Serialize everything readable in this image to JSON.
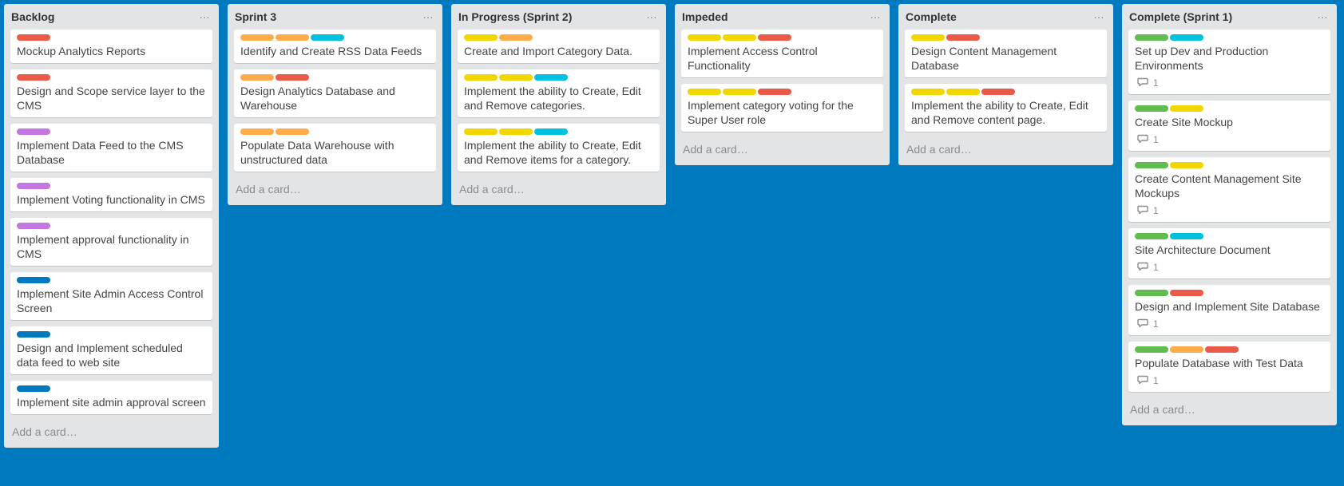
{
  "colors": {
    "board_background": "#0079bf",
    "green": "#61bd4f",
    "yellow": "#f2d600",
    "orange": "#ffab4a",
    "red": "#eb5a46",
    "purple": "#c377e0",
    "blue": "#0079bf",
    "sky": "#00c2e0"
  },
  "add_card_label": "Add a card…",
  "menu_glyph": "…",
  "lists": [
    {
      "title": "Backlog",
      "cards": [
        {
          "labels": [
            "red"
          ],
          "title": "Mockup Analytics Reports"
        },
        {
          "labels": [
            "red"
          ],
          "title": "Design and Scope service layer to the CMS"
        },
        {
          "labels": [
            "purple"
          ],
          "title": "Implement Data Feed to the CMS Database"
        },
        {
          "labels": [
            "purple"
          ],
          "title": "Implement Voting functionality in CMS"
        },
        {
          "labels": [
            "purple"
          ],
          "title": "Implement approval functionality in CMS"
        },
        {
          "labels": [
            "blue"
          ],
          "title": "Implement Site Admin Access Control Screen"
        },
        {
          "labels": [
            "blue"
          ],
          "title": "Design and Implement scheduled data feed to web site"
        },
        {
          "labels": [
            "blue"
          ],
          "title": "Implement site admin approval screen"
        }
      ]
    },
    {
      "title": "Sprint 3",
      "cards": [
        {
          "labels": [
            "orange",
            "orange",
            "sky"
          ],
          "title": "Identify and Create RSS Data Feeds"
        },
        {
          "labels": [
            "orange",
            "red"
          ],
          "title": "Design Analytics Database and Warehouse"
        },
        {
          "labels": [
            "orange",
            "orange"
          ],
          "title": "Populate Data Warehouse with unstructured data"
        }
      ]
    },
    {
      "title": "In Progress (Sprint 2)",
      "cards": [
        {
          "labels": [
            "yellow",
            "orange"
          ],
          "title": "Create and Import Category Data."
        },
        {
          "labels": [
            "yellow",
            "yellow",
            "sky"
          ],
          "title": "Implement the ability to Create, Edit and Remove categories."
        },
        {
          "labels": [
            "yellow",
            "yellow",
            "sky"
          ],
          "title": "Implement the ability to Create, Edit and Remove items for a category."
        }
      ]
    },
    {
      "title": "Impeded",
      "cards": [
        {
          "labels": [
            "yellow",
            "yellow",
            "red"
          ],
          "title": "Implement Access Control Functionality"
        },
        {
          "labels": [
            "yellow",
            "yellow",
            "red"
          ],
          "title": "Implement category voting for the Super User role"
        }
      ]
    },
    {
      "title": "Complete",
      "cards": [
        {
          "labels": [
            "yellow",
            "red"
          ],
          "title": "Design Content Management Database"
        },
        {
          "labels": [
            "yellow",
            "yellow",
            "red"
          ],
          "title": "Implement the ability to Create, Edit and Remove content page."
        }
      ]
    },
    {
      "title": "Complete (Sprint 1)",
      "cards": [
        {
          "labels": [
            "green",
            "sky"
          ],
          "title": "Set up Dev and Production Environments",
          "comments": "1"
        },
        {
          "labels": [
            "green",
            "yellow"
          ],
          "title": "Create Site Mockup",
          "comments": "1"
        },
        {
          "labels": [
            "green",
            "yellow"
          ],
          "title": "Create Content Management Site Mockups",
          "comments": "1"
        },
        {
          "labels": [
            "green",
            "sky"
          ],
          "title": "Site Architecture Document",
          "comments": "1"
        },
        {
          "labels": [
            "green",
            "red"
          ],
          "title": "Design and Implement Site Database",
          "comments": "1"
        },
        {
          "labels": [
            "green",
            "orange",
            "red"
          ],
          "title": "Populate Database with Test Data",
          "comments": "1"
        }
      ]
    }
  ]
}
